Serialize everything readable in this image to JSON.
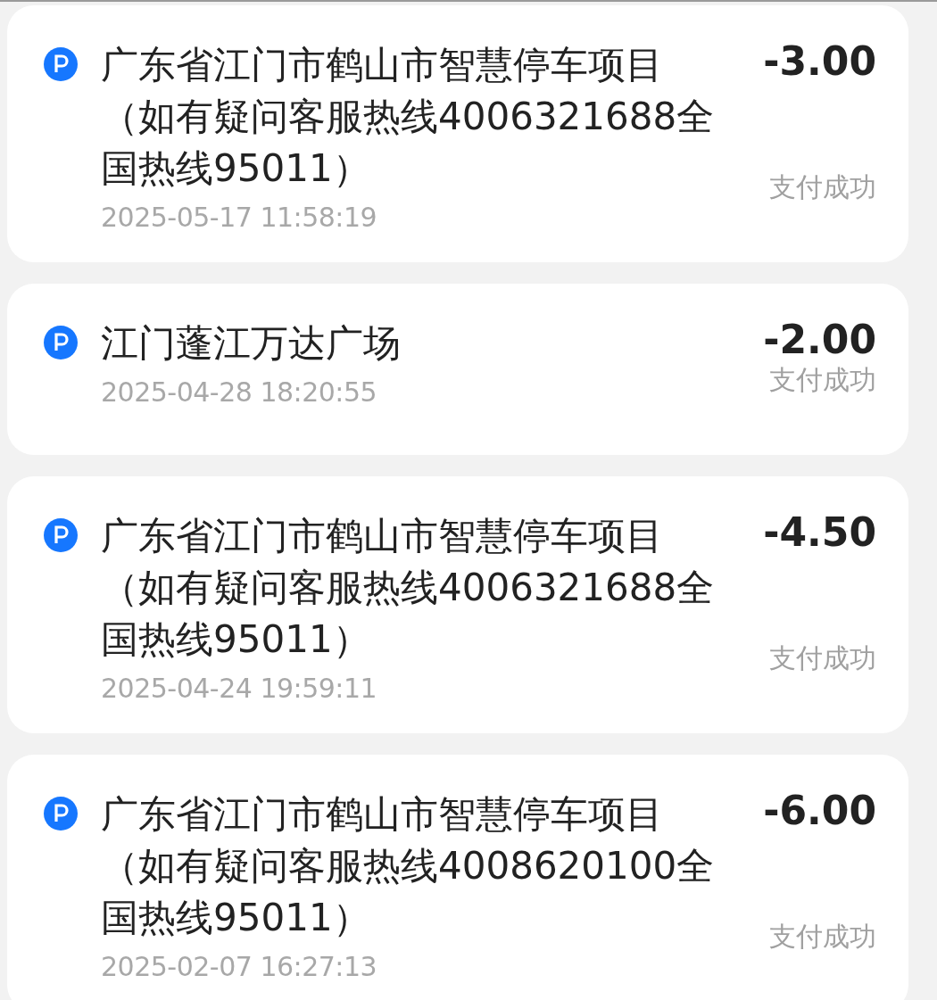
{
  "transactions": [
    {
      "title": "广东省江门市鹤山市智慧停车项目（如有疑问客服热线4006321688全国热线95011）",
      "time": "2025-05-17 11:58:19",
      "amount": "-3.00",
      "status": "支付成功"
    },
    {
      "title": "江门蓬江万达广场",
      "time": "2025-04-28 18:20:55",
      "amount": "-2.00",
      "status": "支付成功"
    },
    {
      "title": "广东省江门市鹤山市智慧停车项目（如有疑问客服热线4006321688全国热线95011）",
      "time": "2025-04-24 19:59:11",
      "amount": "-4.50",
      "status": "支付成功"
    },
    {
      "title": "广东省江门市鹤山市智慧停车项目（如有疑问客服热线4008620100全国热线95011）",
      "time": "2025-02-07 16:27:13",
      "amount": "-6.00",
      "status": "支付成功"
    }
  ]
}
